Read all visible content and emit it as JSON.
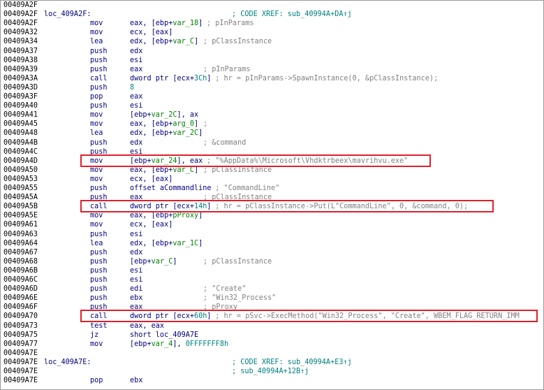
{
  "lines": [
    {
      "addr": "00409A2F",
      "label": "",
      "mnem": "",
      "ops": [],
      "comment": ""
    },
    {
      "addr": "00409A2F",
      "label": "loc_409A2F:",
      "mnem": "",
      "ops": [],
      "comment": "; CODE XREF: sub_40994A+DA↑j"
    },
    {
      "addr": "00409A2F",
      "label": "",
      "mnem": "mov",
      "ops": [
        {
          "t": "eax, [ebp+"
        },
        {
          "t": "var_18",
          "c": "var"
        },
        {
          "t": "]"
        }
      ],
      "comment": "; pInParams"
    },
    {
      "addr": "00409A32",
      "label": "",
      "mnem": "mov",
      "ops": [
        {
          "t": "ecx, [eax]"
        }
      ],
      "comment": ""
    },
    {
      "addr": "00409A34",
      "label": "",
      "mnem": "lea",
      "ops": [
        {
          "t": "edx, [ebp+"
        },
        {
          "t": "var_C",
          "c": "var"
        },
        {
          "t": "]"
        }
      ],
      "comment": "; pClassInstance"
    },
    {
      "addr": "00409A37",
      "label": "",
      "mnem": "push",
      "ops": [
        {
          "t": "edx"
        }
      ],
      "comment": ""
    },
    {
      "addr": "00409A38",
      "label": "",
      "mnem": "push",
      "ops": [
        {
          "t": "esi"
        }
      ],
      "comment": ""
    },
    {
      "addr": "00409A39",
      "label": "",
      "mnem": "push",
      "ops": [
        {
          "t": "eax"
        }
      ],
      "comment": "; pInParams"
    },
    {
      "addr": "00409A3A",
      "label": "",
      "mnem": "call",
      "ops": [
        {
          "t": "dword ptr [ecx+"
        },
        {
          "t": "3Ch",
          "c": "num"
        },
        {
          "t": "]"
        }
      ],
      "comment": "; hr = pInParams->SpawnInstance(0, &pClassInstance);"
    },
    {
      "addr": "00409A3D",
      "label": "",
      "mnem": "push",
      "ops": [
        {
          "t": "8",
          "c": "num"
        }
      ],
      "comment": ""
    },
    {
      "addr": "00409A3F",
      "label": "",
      "mnem": "pop",
      "ops": [
        {
          "t": "eax"
        }
      ],
      "comment": ""
    },
    {
      "addr": "00409A40",
      "label": "",
      "mnem": "push",
      "ops": [
        {
          "t": "esi"
        }
      ],
      "comment": ""
    },
    {
      "addr": "00409A41",
      "label": "",
      "mnem": "mov",
      "ops": [
        {
          "t": "[ebp+"
        },
        {
          "t": "var_2C",
          "c": "var"
        },
        {
          "t": "], ax"
        }
      ],
      "comment": ""
    },
    {
      "addr": "00409A45",
      "label": "",
      "mnem": "mov",
      "ops": [
        {
          "t": "eax, [ebp+"
        },
        {
          "t": "arg_0",
          "c": "var"
        },
        {
          "t": "]"
        }
      ],
      "comment": ";"
    },
    {
      "addr": "00409A48",
      "label": "",
      "mnem": "lea",
      "ops": [
        {
          "t": "edx, [ebp+"
        },
        {
          "t": "var_2C",
          "c": "var"
        },
        {
          "t": "]"
        }
      ],
      "comment": ""
    },
    {
      "addr": "00409A4B",
      "label": "",
      "mnem": "push",
      "ops": [
        {
          "t": "edx"
        }
      ],
      "comment": "; &command"
    },
    {
      "addr": "00409A4C",
      "label": "",
      "mnem": "push",
      "ops": [
        {
          "t": "esi"
        }
      ],
      "comment": ""
    },
    {
      "addr": "00409A4D",
      "label": "",
      "mnem": "mov",
      "ops": [
        {
          "t": "[ebp+"
        },
        {
          "t": "var_24",
          "c": "var"
        },
        {
          "t": "], eax"
        }
      ],
      "comment": "; \"%AppData%\\Microsoft\\Vhdktrbeex\\mavrihvu.exe\""
    },
    {
      "addr": "00409A50",
      "label": "",
      "mnem": "mov",
      "ops": [
        {
          "t": "eax, [ebp+"
        },
        {
          "t": "var_C",
          "c": "var"
        },
        {
          "t": "]"
        }
      ],
      "comment": "; pClassInstance"
    },
    {
      "addr": "00409A53",
      "label": "",
      "mnem": "mov",
      "ops": [
        {
          "t": "ecx, [eax]"
        }
      ],
      "comment": ""
    },
    {
      "addr": "00409A55",
      "label": "",
      "mnem": "push",
      "ops": [
        {
          "t": "offset aCommandline"
        }
      ],
      "comment": "; \"CommandLine\""
    },
    {
      "addr": "00409A5A",
      "label": "",
      "mnem": "push",
      "ops": [
        {
          "t": "eax"
        }
      ],
      "comment": "; pClassInstance"
    },
    {
      "addr": "00409A5B",
      "label": "",
      "mnem": "call",
      "ops": [
        {
          "t": "dword ptr [ecx+"
        },
        {
          "t": "14h",
          "c": "num"
        },
        {
          "t": "]"
        }
      ],
      "comment": "; hr = pClassInstance->Put(L\"CommandLine\", 0, &command, 0);"
    },
    {
      "addr": "00409A5E",
      "label": "",
      "mnem": "mov",
      "ops": [
        {
          "t": "eax, [ebp+"
        },
        {
          "t": "pProxy",
          "c": "var"
        },
        {
          "t": "]"
        }
      ],
      "comment": ""
    },
    {
      "addr": "00409A61",
      "label": "",
      "mnem": "mov",
      "ops": [
        {
          "t": "ecx, [eax]"
        }
      ],
      "comment": ""
    },
    {
      "addr": "00409A63",
      "label": "",
      "mnem": "push",
      "ops": [
        {
          "t": "esi"
        }
      ],
      "comment": ""
    },
    {
      "addr": "00409A64",
      "label": "",
      "mnem": "lea",
      "ops": [
        {
          "t": "edx, [ebp+"
        },
        {
          "t": "var_1C",
          "c": "var"
        },
        {
          "t": "]"
        }
      ],
      "comment": ""
    },
    {
      "addr": "00409A67",
      "label": "",
      "mnem": "push",
      "ops": [
        {
          "t": "edx"
        }
      ],
      "comment": ""
    },
    {
      "addr": "00409A68",
      "label": "",
      "mnem": "push",
      "ops": [
        {
          "t": "[ebp+"
        },
        {
          "t": "var_C",
          "c": "var"
        },
        {
          "t": "]"
        }
      ],
      "comment": "; pClassInstance"
    },
    {
      "addr": "00409A6B",
      "label": "",
      "mnem": "push",
      "ops": [
        {
          "t": "esi"
        }
      ],
      "comment": ""
    },
    {
      "addr": "00409A6C",
      "label": "",
      "mnem": "push",
      "ops": [
        {
          "t": "esi"
        }
      ],
      "comment": ""
    },
    {
      "addr": "00409A6D",
      "label": "",
      "mnem": "push",
      "ops": [
        {
          "t": "edi"
        }
      ],
      "comment": "; \"Create\""
    },
    {
      "addr": "00409A6E",
      "label": "",
      "mnem": "push",
      "ops": [
        {
          "t": "ebx"
        }
      ],
      "comment": "; \"Win32_Process\""
    },
    {
      "addr": "00409A6F",
      "label": "",
      "mnem": "push",
      "ops": [
        {
          "t": "eax"
        }
      ],
      "comment": "; pProxy"
    },
    {
      "addr": "00409A70",
      "label": "",
      "mnem": "call",
      "ops": [
        {
          "t": "dword ptr [ecx+"
        },
        {
          "t": "60h",
          "c": "num"
        },
        {
          "t": "]"
        }
      ],
      "comment": "; hr = pSvc->ExecMethod(\"Win32_Process\", \"Create\", WBEM_FLAG_RETURN_IMM"
    },
    {
      "addr": "00409A73",
      "label": "",
      "mnem": "test",
      "ops": [
        {
          "t": "eax, eax"
        }
      ],
      "comment": ""
    },
    {
      "addr": "00409A75",
      "label": "",
      "mnem": "jz",
      "ops": [
        {
          "t": "short loc_409A7E"
        }
      ],
      "comment": ""
    },
    {
      "addr": "00409A77",
      "label": "",
      "mnem": "mov",
      "ops": [
        {
          "t": "[ebp+"
        },
        {
          "t": "var_4",
          "c": "var"
        },
        {
          "t": "], "
        },
        {
          "t": "0FFFFFFF8h",
          "c": "num"
        }
      ],
      "comment": ""
    },
    {
      "addr": "00409A7E",
      "label": "",
      "mnem": "",
      "ops": [],
      "comment": ""
    },
    {
      "addr": "00409A7E",
      "label": "loc_409A7E:",
      "mnem": "",
      "ops": [],
      "comment": "; CODE XREF: sub_40994A+E3↑j"
    },
    {
      "addr": "00409A7E",
      "label": "",
      "mnem": "",
      "ops": [],
      "comment": "; sub_40994A+12B↑j"
    },
    {
      "addr": "00409A7E",
      "label": "",
      "mnem": "pop",
      "ops": [
        {
          "t": "ebx"
        }
      ],
      "comment": ""
    }
  ],
  "highlights": [
    {
      "line": 17,
      "note": "mov [ebp+var_24], eax ; \"%AppData%\\Microsoft\\Vhdktrbeex\\mavrihvu.exe\""
    },
    {
      "line": 22,
      "note": "call dword ptr [ecx+14h] ; hr = pClassInstance->Put(L\"CommandLine\", 0, &command, 0);"
    },
    {
      "line": 34,
      "note": "call dword ptr [ecx+60h] ; hr = pSvc->ExecMethod(\"Win32_Process\", \"Create\", WBEM_FLAG_RETURN_IMM"
    }
  ],
  "colors": {
    "text": "#000080",
    "address": "#000000",
    "variable": "#008000",
    "number": "#008080",
    "comment": "#808080",
    "highlight_border": "#e0202a"
  }
}
